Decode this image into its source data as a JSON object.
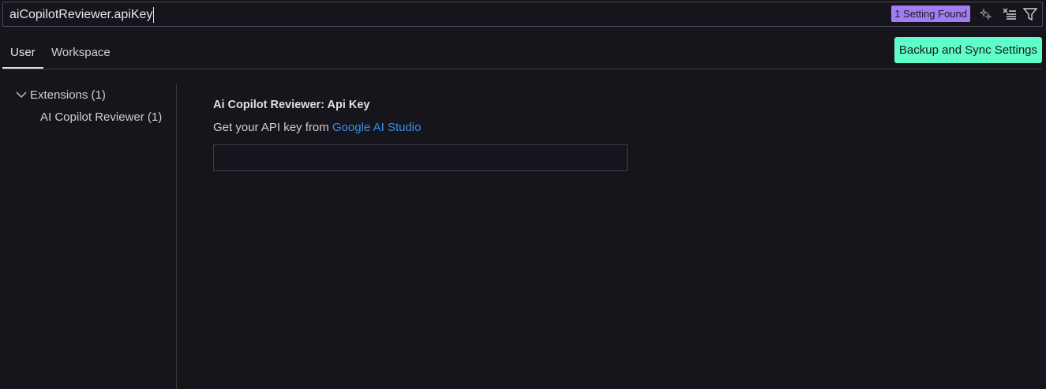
{
  "search": {
    "value": "aiCopilotReviewer.apiKey",
    "results_badge": "1 Setting Found"
  },
  "tabs": [
    {
      "label": "User",
      "active": true
    },
    {
      "label": "Workspace",
      "active": false
    }
  ],
  "sync_button": "Backup and Sync Settings",
  "tree": {
    "group": "Extensions (1)",
    "item": "AI Copilot Reviewer (1)"
  },
  "setting": {
    "title_prefix": "Ai Copilot Reviewer: ",
    "title_name": "Api Key",
    "description": "Get your API key from ",
    "link": "Google AI Studio",
    "value": ""
  },
  "colors": {
    "badge": "#a37cf3",
    "sync": "#5ffdc8",
    "link": "#3a8ee6"
  }
}
